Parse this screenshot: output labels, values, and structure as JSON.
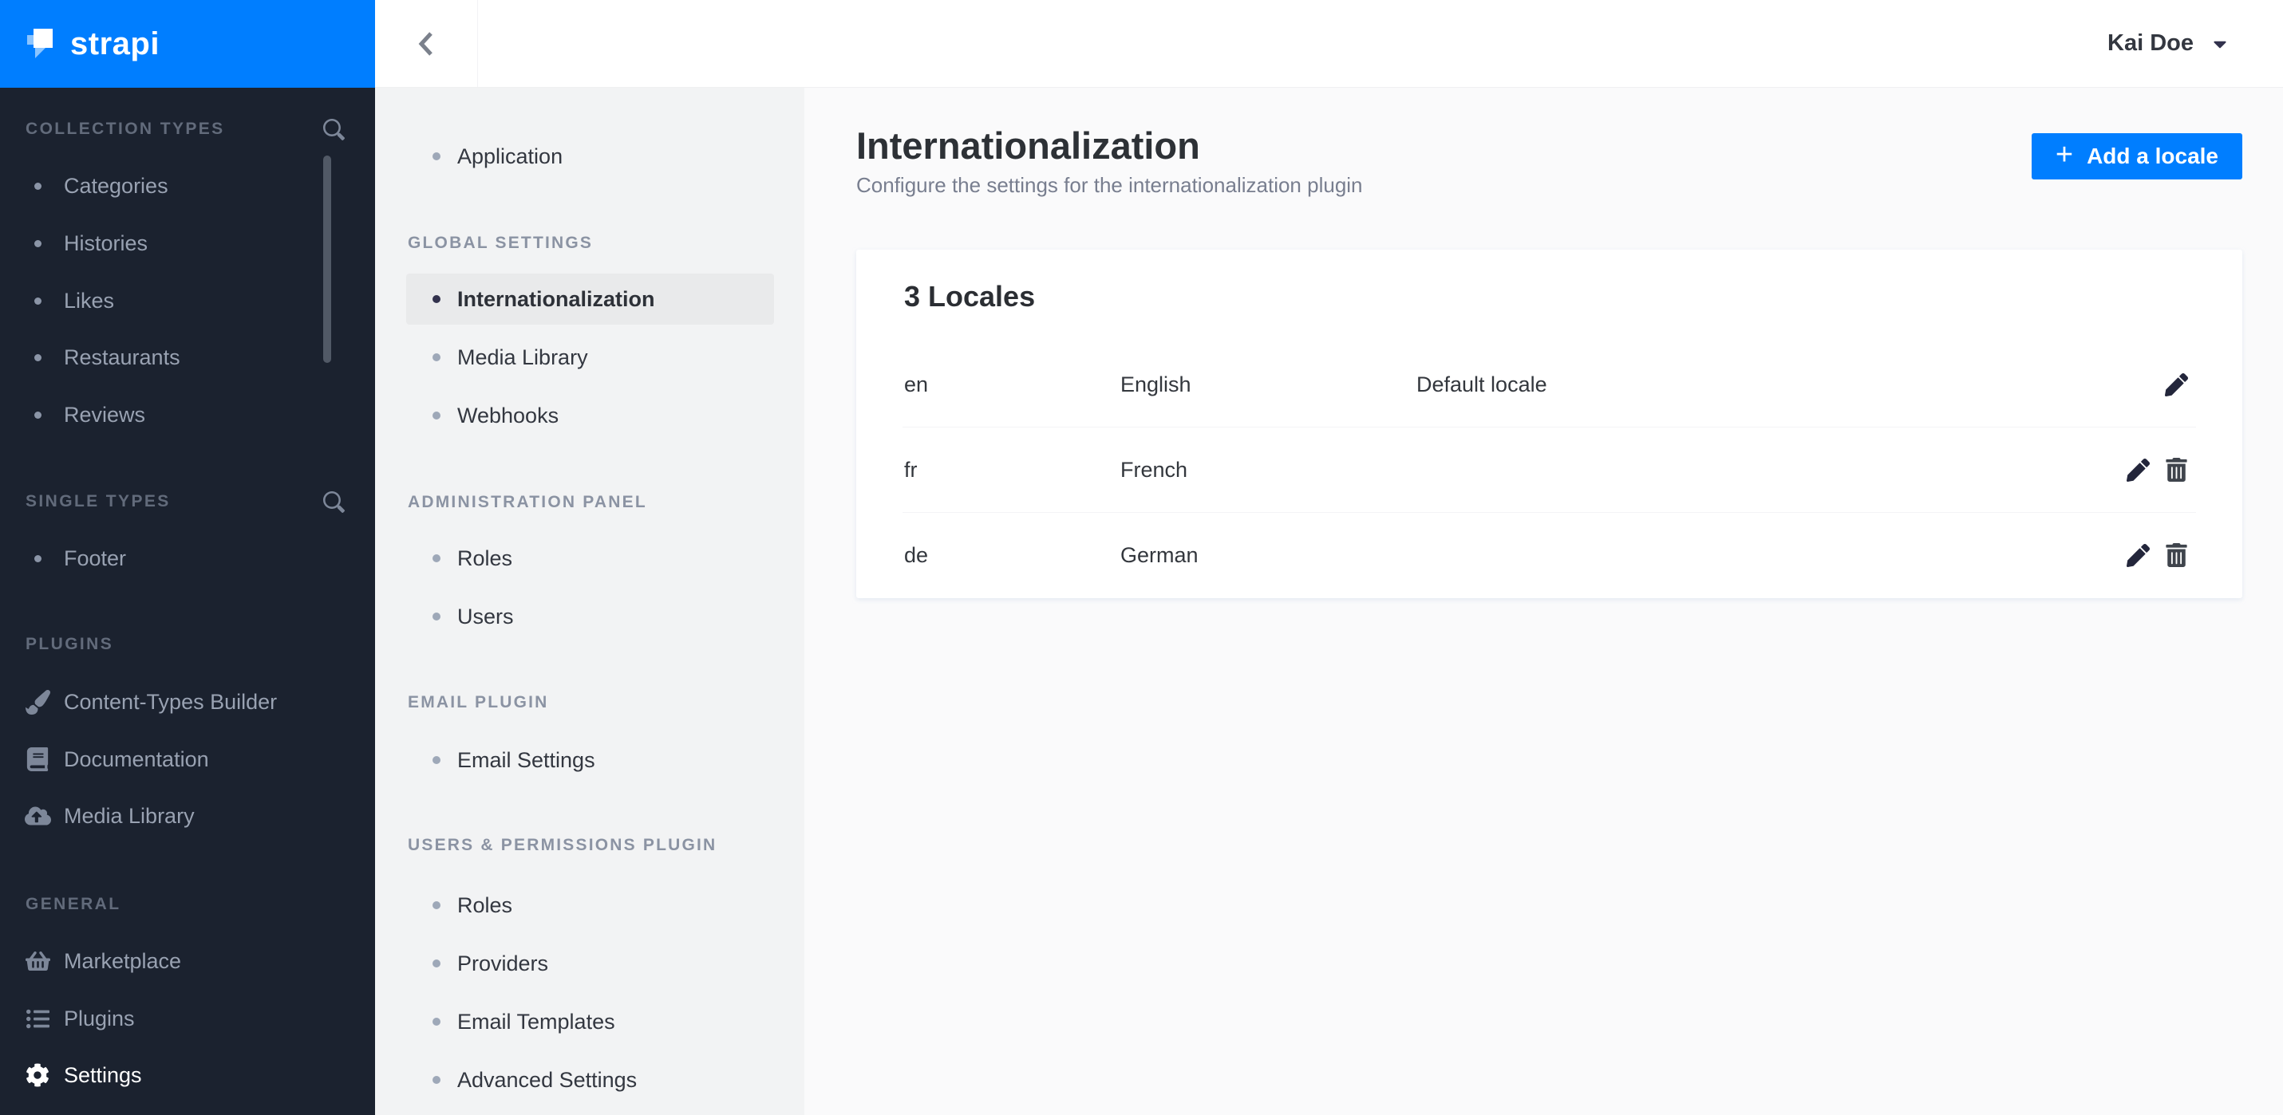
{
  "brand": {
    "name": "strapi"
  },
  "left_menu": {
    "sections": [
      {
        "label": "COLLECTION TYPES",
        "has_search": true,
        "items": [
          {
            "label": "Categories",
            "icon": "bullet"
          },
          {
            "label": "Histories",
            "icon": "bullet"
          },
          {
            "label": "Likes",
            "icon": "bullet"
          },
          {
            "label": "Restaurants",
            "icon": "bullet"
          },
          {
            "label": "Reviews",
            "icon": "bullet"
          }
        ]
      },
      {
        "label": "SINGLE TYPES",
        "has_search": true,
        "items": [
          {
            "label": "Footer",
            "icon": "bullet"
          }
        ]
      },
      {
        "label": "PLUGINS",
        "has_search": false,
        "items": [
          {
            "label": "Content-Types Builder",
            "icon": "paintbrush-icon"
          },
          {
            "label": "Documentation",
            "icon": "book-icon"
          },
          {
            "label": "Media Library",
            "icon": "cloud-upload-icon"
          }
        ]
      },
      {
        "label": "GENERAL",
        "has_search": false,
        "items": [
          {
            "label": "Marketplace",
            "icon": "basket-icon"
          },
          {
            "label": "Plugins",
            "icon": "list-icon"
          },
          {
            "label": "Settings",
            "icon": "gear-icon",
            "active": true
          }
        ]
      }
    ]
  },
  "topbar": {
    "user_name": "Kai Doe"
  },
  "settings_menu": {
    "sections": [
      {
        "header": "",
        "items": [
          {
            "label": "Application"
          }
        ]
      },
      {
        "header": "GLOBAL SETTINGS",
        "items": [
          {
            "label": "Internationalization",
            "selected": true
          },
          {
            "label": "Media Library"
          },
          {
            "label": "Webhooks"
          }
        ]
      },
      {
        "header": "ADMINISTRATION PANEL",
        "items": [
          {
            "label": "Roles"
          },
          {
            "label": "Users"
          }
        ]
      },
      {
        "header": "EMAIL PLUGIN",
        "items": [
          {
            "label": "Email Settings"
          }
        ]
      },
      {
        "header": "USERS & PERMISSIONS PLUGIN",
        "items": [
          {
            "label": "Roles"
          },
          {
            "label": "Providers"
          },
          {
            "label": "Email Templates"
          },
          {
            "label": "Advanced Settings"
          }
        ]
      }
    ]
  },
  "page": {
    "title": "Internationalization",
    "subtitle": "Configure the settings for the internationalization plugin",
    "add_locale_button": "Add a locale",
    "plus_sign": "+"
  },
  "locales_card": {
    "title": "3 Locales",
    "rows": [
      {
        "code": "en",
        "name": "English",
        "note": "Default locale",
        "can_delete": false
      },
      {
        "code": "fr",
        "name": "French",
        "note": "",
        "can_delete": true
      },
      {
        "code": "de",
        "name": "German",
        "note": "",
        "can_delete": true
      }
    ]
  },
  "colors": {
    "brand_blue": "#007eff",
    "left_menu_bg": "#1b222f",
    "settings_panel_bg": "#f2f3f4",
    "selected_item_bg": "#e9eaeb",
    "main_bg": "#fafafb"
  }
}
